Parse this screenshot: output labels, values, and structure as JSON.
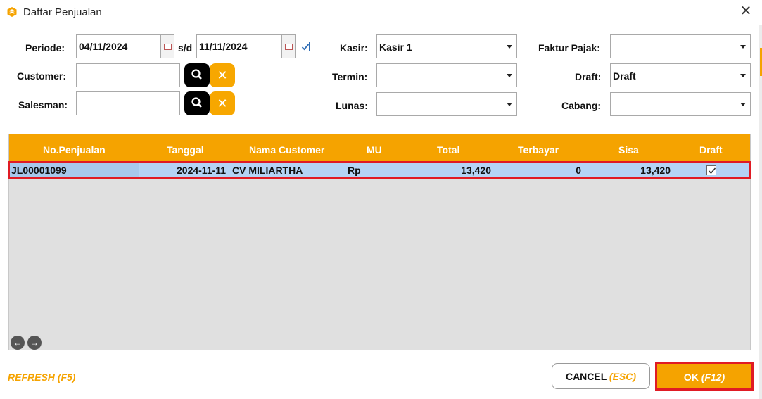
{
  "window": {
    "title": "Daftar Penjualan",
    "icon": "app-logo-icon",
    "close_icon": "close-icon",
    "close_glyph": "✕"
  },
  "filters": {
    "periode_label": "Periode:",
    "periode_from": "04/11/2024",
    "sd_label": "s/d",
    "periode_to": "11/11/2024",
    "periode_checked": true,
    "customer_label": "Customer:",
    "customer_value": "",
    "salesman_label": "Salesman:",
    "salesman_value": "",
    "kasir_label": "Kasir:",
    "kasir_value": "Kasir 1",
    "termin_label": "Termin:",
    "termin_value": "",
    "lunas_label": "Lunas:",
    "lunas_value": "",
    "faktur_pajak_label": "Faktur Pajak:",
    "faktur_pajak_value": "",
    "draft_label": "Draft:",
    "draft_value": "Draft",
    "cabang_label": "Cabang:",
    "cabang_value": "",
    "clear_glyph": "✕"
  },
  "table": {
    "columns": [
      "No.Penjualan",
      "Tanggal",
      "Nama Customer",
      "MU",
      "Total",
      "Terbayar",
      "Sisa",
      "Draft"
    ],
    "rows": [
      {
        "no_penjualan": "JL00001099",
        "tanggal": "2024-11-11",
        "nama_customer": "CV MILIARTHA",
        "mu": "Rp",
        "total": "13,420",
        "terbayar": "0",
        "sisa": "13,420",
        "draft": true
      }
    ],
    "nav_prev_glyph": "←",
    "nav_next_glyph": "→"
  },
  "footer": {
    "refresh_label": "REFRESH (F5)",
    "cancel_label": "CANCEL",
    "cancel_key": "(ESC)",
    "ok_label": "OK",
    "ok_key": "(F12)"
  },
  "colors": {
    "accent": "#f5a300",
    "highlight": "#e01b24",
    "selected_row": "#b4d3f5"
  }
}
